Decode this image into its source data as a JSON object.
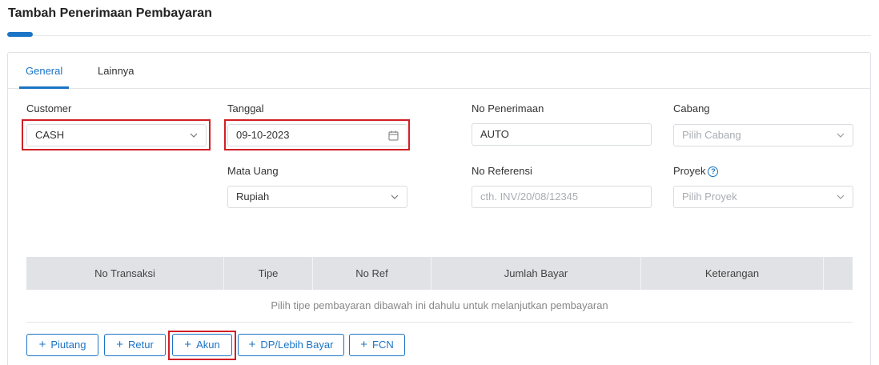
{
  "page": {
    "title": "Tambah Penerimaan Pembayaran"
  },
  "tabs": [
    {
      "label": "General",
      "active": true
    },
    {
      "label": "Lainnya",
      "active": false
    }
  ],
  "form": {
    "customer": {
      "label": "Customer",
      "value": "CASH"
    },
    "tanggal": {
      "label": "Tanggal",
      "value": "09-10-2023"
    },
    "no_penerimaan": {
      "label": "No Penerimaan",
      "value": "AUTO"
    },
    "cabang": {
      "label": "Cabang",
      "placeholder": "Pilih Cabang"
    },
    "mata_uang": {
      "label": "Mata Uang",
      "value": "Rupiah"
    },
    "no_referensi": {
      "label": "No Referensi",
      "placeholder": "cth. INV/20/08/12345"
    },
    "proyek": {
      "label": "Proyek",
      "placeholder": "Pilih Proyek",
      "help": "?"
    }
  },
  "table": {
    "columns": [
      "No Transaksi",
      "Tipe",
      "No Ref",
      "Jumlah Bayar",
      "Keterangan"
    ],
    "empty_message": "Pilih tipe pembayaran dibawah ini dahulu untuk melanjutkan pembayaran"
  },
  "buttons": {
    "piutang": "Piutang",
    "retur": "Retur",
    "akun": "Akun",
    "dp": "DP/Lebih Bayar",
    "fcn": "FCN",
    "plus": "+"
  },
  "colors": {
    "accent": "#1b74c5",
    "highlight": "#d21f26",
    "table_header": "#e0e2e5"
  },
  "icons": {
    "dropdown": "chevron-down-icon",
    "calendar": "calendar-icon",
    "help": "help-circle-icon",
    "add": "plus-icon"
  }
}
